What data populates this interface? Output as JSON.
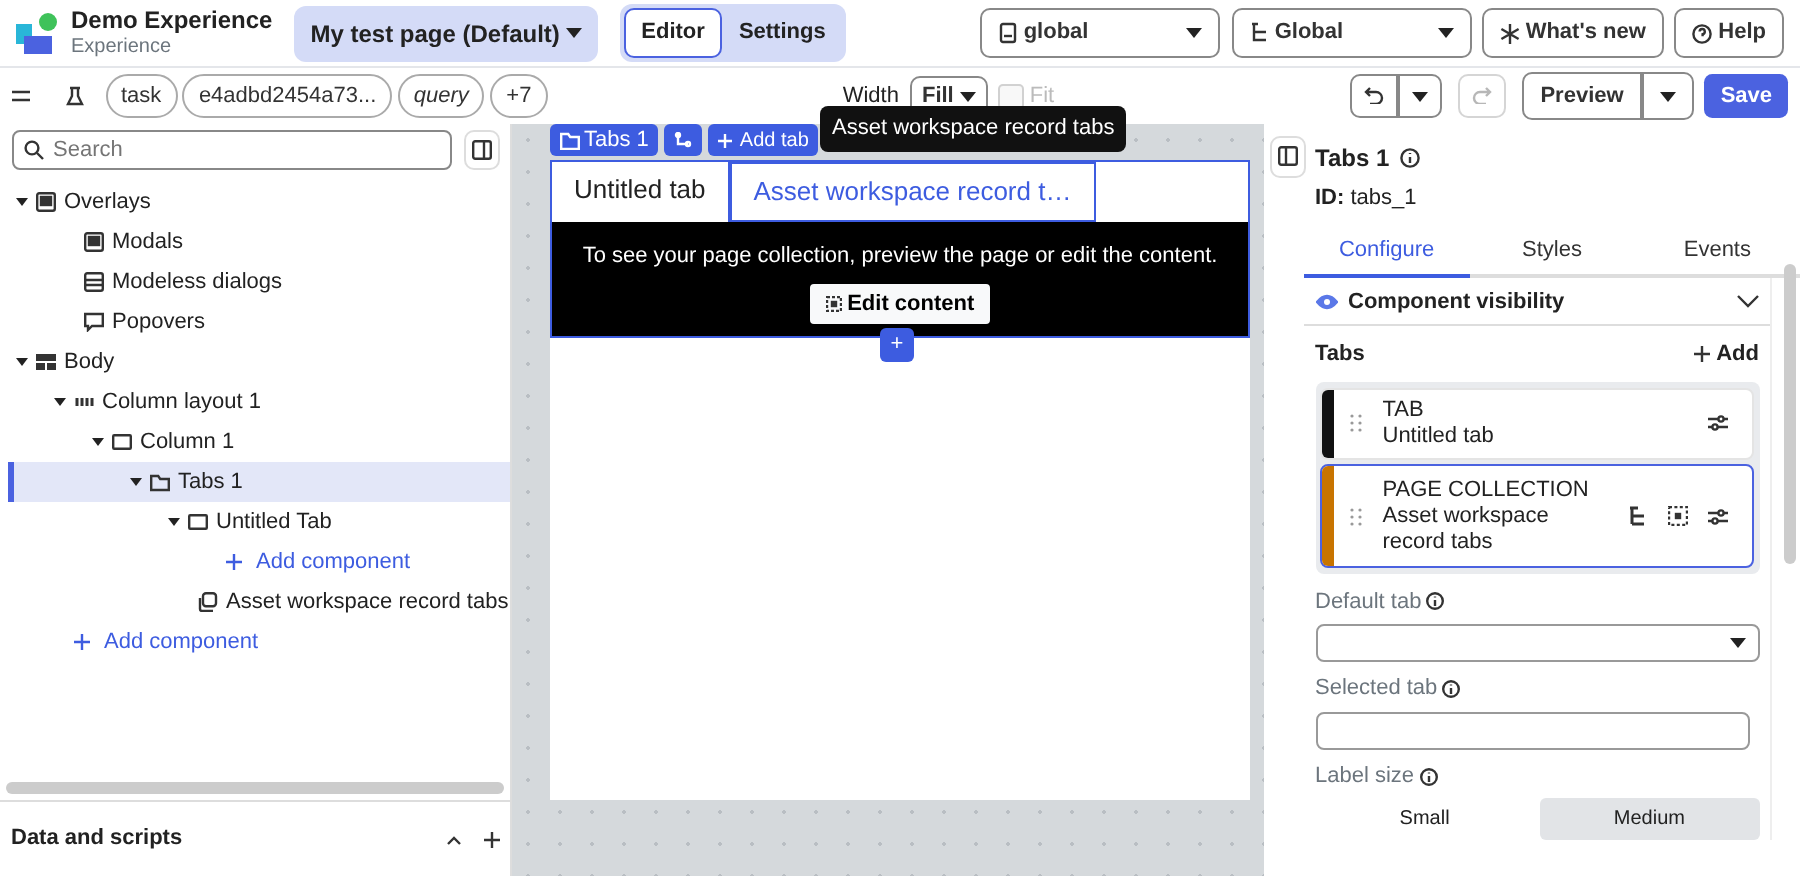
{
  "app": {
    "title": "Demo Experience",
    "subtitle": "Experience",
    "page_menu": "My test page (Default)",
    "modes": [
      {
        "label": "Editor",
        "selected": true
      },
      {
        "label": "Settings",
        "selected": false
      }
    ],
    "scope": "global",
    "workspace": "Global",
    "whats_new": "What's new",
    "help": "Help"
  },
  "toolbar": {
    "chips": [
      {
        "label": "task",
        "kind": "param"
      },
      {
        "label": "e4adbd2454a73...",
        "kind": "param"
      },
      {
        "label": "query",
        "kind": "variable"
      },
      {
        "label": "+7",
        "kind": "more"
      }
    ],
    "width_label": "Width",
    "width_value": "Fill",
    "fit": {
      "label": "Fit",
      "checked": false,
      "disabled": true
    },
    "redo_disabled": true,
    "preview": "Preview",
    "save": "Save"
  },
  "sidebar": {
    "search": {
      "placeholder": "Search"
    },
    "tree": [
      {
        "label": "Overlays",
        "kind": "overlay",
        "expanded": true,
        "selected": false,
        "children": [
          {
            "label": "Modals",
            "kind": "modal",
            "selected": false
          },
          {
            "label": "Modeless dialogs",
            "kind": "dialog",
            "selected": false
          },
          {
            "label": "Popovers",
            "kind": "popover",
            "selected": false
          }
        ]
      },
      {
        "label": "Body",
        "kind": "body",
        "expanded": true,
        "selected": false,
        "children": [
          {
            "label": "Column layout 1",
            "kind": "columns",
            "expanded": true,
            "selected": false,
            "children": [
              {
                "label": "Column 1",
                "kind": "column",
                "expanded": true,
                "selected": false,
                "children": [
                  {
                    "label": "Tabs 1",
                    "kind": "tabs",
                    "expanded": true,
                    "selected": true,
                    "children": [
                      {
                        "label": "Untitled Tab",
                        "kind": "column",
                        "expanded": true,
                        "selected": false,
                        "children": [
                          {
                            "label": "Add component",
                            "kind": "add"
                          }
                        ]
                      },
                      {
                        "label": "Asset workspace record tabs",
                        "kind": "collection",
                        "selected": false
                      }
                    ]
                  }
                ]
              }
            ]
          },
          {
            "label": "Add component",
            "kind": "add"
          }
        ]
      }
    ],
    "footer": "Data and scripts"
  },
  "canvas": {
    "component_label": "Tabs 1",
    "add_tab": "Add tab",
    "tabs": [
      {
        "label": "Untitled tab",
        "selected": false
      },
      {
        "label": "Asset workspace record t…",
        "selected": true
      }
    ],
    "message": "To see your page collection, preview the page or edit the content.",
    "edit_button": "Edit content",
    "add_button": "+",
    "tooltip": "Asset workspace record tabs"
  },
  "panel": {
    "title": "Tabs 1",
    "id": "**ID:** tabs_1",
    "tabs": [
      {
        "label": "Configure",
        "selected": true
      },
      {
        "label": "Styles",
        "selected": false
      },
      {
        "label": "Events",
        "selected": false
      }
    ],
    "visibility": {
      "label": "Component visibility",
      "expanded": false
    },
    "tabs_heading": "Tabs",
    "add": "Add",
    "tab_items": [
      {
        "type": "TAB",
        "label": "Untitled tab",
        "color": "#111111",
        "selected": false,
        "kind": "tab"
      },
      {
        "type": "PAGE COLLECTION",
        "label": "Asset workspace record tabs",
        "color": "#c87400",
        "selected": true,
        "kind": "collection"
      }
    ],
    "default_tab": {
      "label": "Default tab"
    },
    "selected_tab": {
      "label": "Selected tab"
    },
    "label_size": {
      "label": "Label size",
      "options": [
        {
          "label": "Small",
          "selected": false
        },
        {
          "label": "Medium",
          "selected": true
        }
      ]
    }
  }
}
